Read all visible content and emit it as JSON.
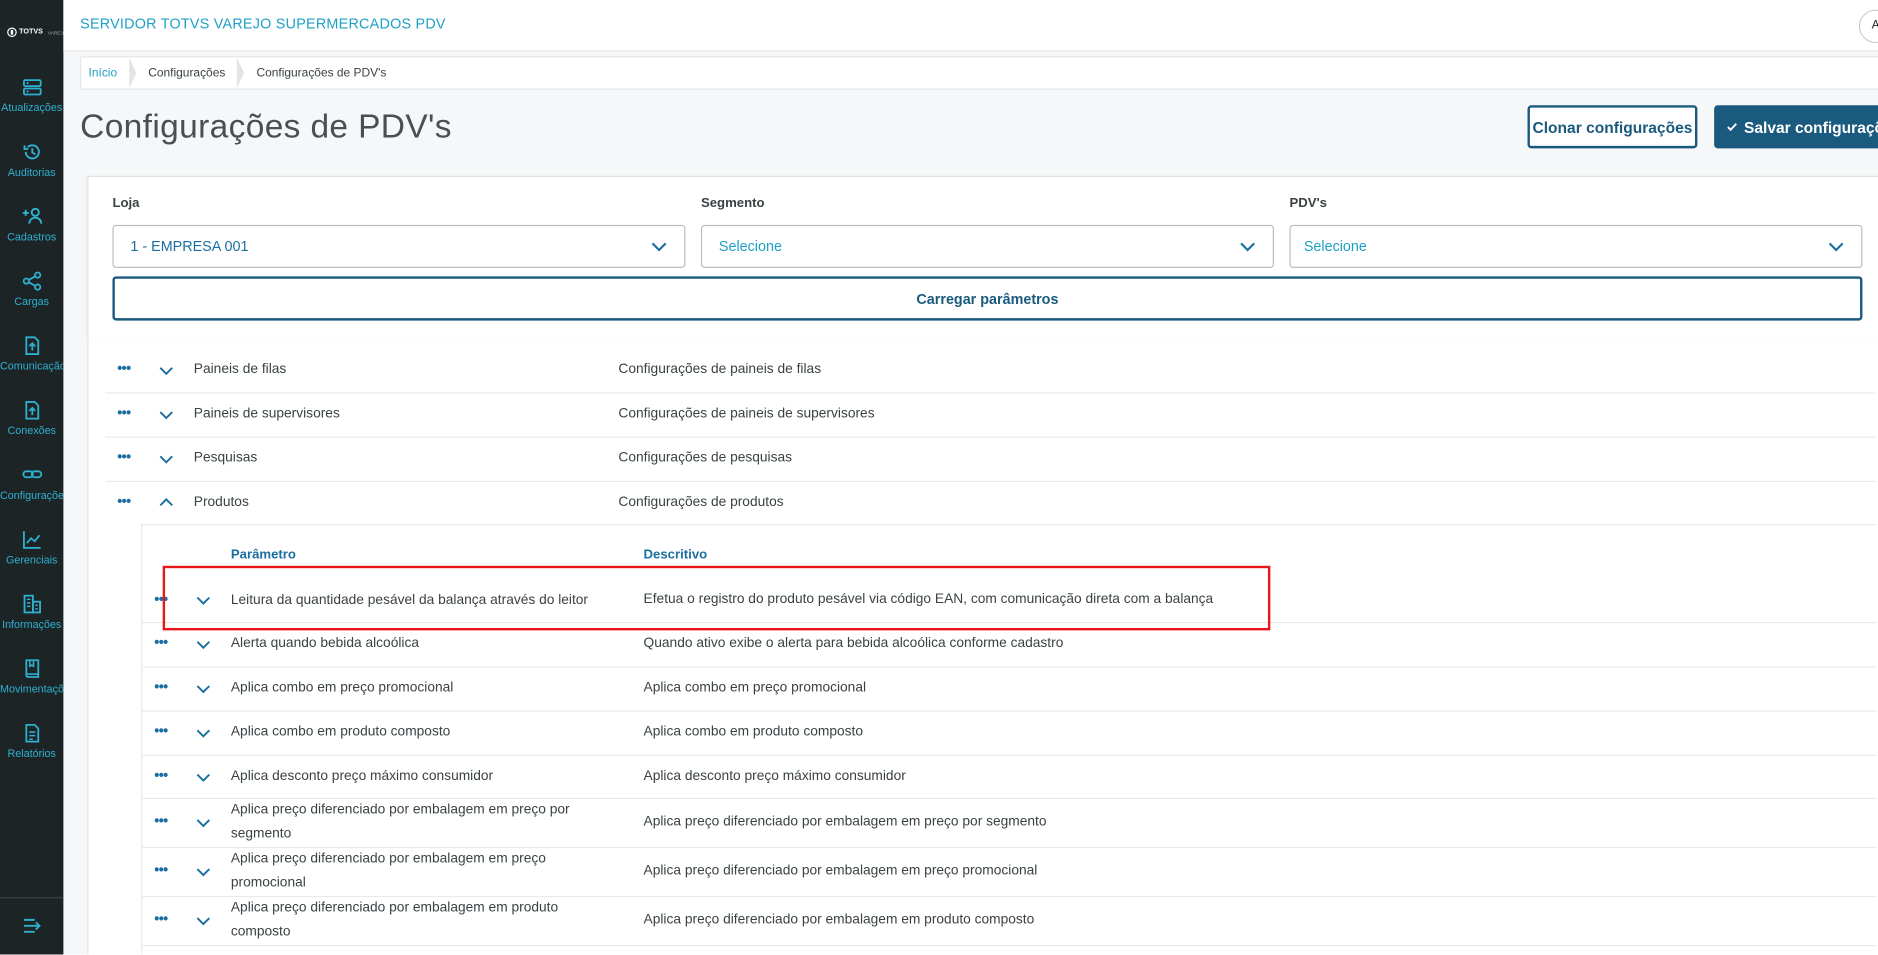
{
  "app": {
    "logo_text": "TOTVS",
    "logo_sub": "VAREJO",
    "title": "SERVIDOR TOTVS VAREJO SUPERMERCADOS PDV",
    "user_initial": "A"
  },
  "sidebar": {
    "items": [
      {
        "label": "Atualizações",
        "icon": "server-icon"
      },
      {
        "label": "Auditorias",
        "icon": "history-icon"
      },
      {
        "label": "Cadastros",
        "icon": "add-user-icon"
      },
      {
        "label": "Cargas",
        "icon": "share-icon"
      },
      {
        "label": "Comunicação",
        "icon": "upload-doc-icon"
      },
      {
        "label": "Conexões",
        "icon": "upload-doc-icon"
      },
      {
        "label": "Configurações",
        "icon": "link-icon"
      },
      {
        "label": "Gerenciais",
        "icon": "chart-icon"
      },
      {
        "label": "Informações",
        "icon": "buildings-icon"
      },
      {
        "label": "Movimentações",
        "icon": "book-icon"
      },
      {
        "label": "Relatórios",
        "icon": "document-icon"
      }
    ],
    "collapse_icon": "collapse-menu-icon"
  },
  "breadcrumb": [
    "Início",
    "Configurações",
    "Configurações de PDV's"
  ],
  "page": {
    "title": "Configurações de PDV's",
    "clone_button": "Clonar configurações",
    "save_button": "Salvar configurações"
  },
  "filters": {
    "store": {
      "label": "Loja",
      "value": "1 - EMPRESA 001"
    },
    "segment": {
      "label": "Segmento",
      "value": "Selecione"
    },
    "pdvs": {
      "label": "PDV's",
      "value": "Selecione"
    },
    "load_button": "Carregar parâmetros"
  },
  "groups": [
    {
      "name": "Paineis de filas",
      "description": "Configurações de paineis de filas",
      "expanded": false
    },
    {
      "name": "Paineis de supervisores",
      "description": "Configurações de paineis de supervisores",
      "expanded": false
    },
    {
      "name": "Pesquisas",
      "description": "Configurações de pesquisas",
      "expanded": false
    },
    {
      "name": "Produtos",
      "description": "Configurações de produtos",
      "expanded": true
    }
  ],
  "parameters": {
    "headers": {
      "name": "Parâmetro",
      "description": "Descritivo"
    },
    "rows": [
      {
        "name": "Leitura da quantidade pesável da balança através do leitor",
        "description": "Efetua o registro do produto pesável via código EAN, com comunicação direta com a balança",
        "highlighted": true
      },
      {
        "name": "Alerta quando bebida alcoólica",
        "description": "Quando ativo exibe o alerta para bebida alcoólica conforme cadastro"
      },
      {
        "name": "Aplica combo em preço promocional",
        "description": "Aplica combo em preço promocional"
      },
      {
        "name": "Aplica combo em produto composto",
        "description": "Aplica combo em produto composto"
      },
      {
        "name": "Aplica desconto preço máximo consumidor",
        "description": "Aplica desconto preço máximo consumidor"
      },
      {
        "name": "Aplica preço diferenciado por embalagem em preço por segmento",
        "description": "Aplica preço diferenciado por embalagem em preço por segmento"
      },
      {
        "name": "Aplica preço diferenciado por embalagem em preço promocional",
        "description": "Aplica preço diferenciado por embalagem em preço promocional"
      },
      {
        "name": "Aplica preço diferenciado por embalagem em produto composto",
        "description": "Aplica preço diferenciado por embalagem em produto composto"
      }
    ]
  },
  "colors": {
    "sidebar_bg": "#1d2426",
    "accent": "#1ea0c6",
    "primary": "#1a5a7e",
    "highlight_border": "#e8151a"
  }
}
